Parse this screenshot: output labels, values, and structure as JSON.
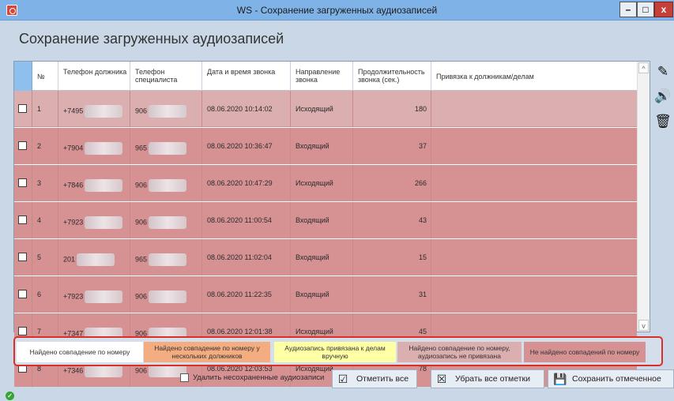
{
  "window": {
    "title": "WS - Сохранение загруженных аудиозаписей",
    "min_glyph": "–",
    "max_glyph": "□",
    "close_glyph": "x"
  },
  "page": {
    "title": "Сохранение загруженных аудиозаписей"
  },
  "grid": {
    "columns": [
      {
        "key": "num",
        "label": "№"
      },
      {
        "key": "debtor_phone",
        "label": "Телефон должника"
      },
      {
        "key": "specialist_phone",
        "label": "Телефон специалиста"
      },
      {
        "key": "datetime",
        "label": "Дата и время звонка"
      },
      {
        "key": "direction",
        "label": "Направление звонка"
      },
      {
        "key": "duration",
        "label": "Продолжительность звонка (сек.)"
      },
      {
        "key": "binding",
        "label": "Привязка к должникам/делам"
      }
    ],
    "rows": [
      {
        "num": "1",
        "debtor_phone": "+7495",
        "specialist_phone": "906",
        "datetime": "08.06.2020 10:14:02",
        "direction": "Исходящий",
        "duration": "180",
        "binding": ""
      },
      {
        "num": "2",
        "debtor_phone": "+7904",
        "specialist_phone": "965",
        "datetime": "08.06.2020 10:36:47",
        "direction": "Входящий",
        "duration": "37",
        "binding": ""
      },
      {
        "num": "3",
        "debtor_phone": "+7846",
        "specialist_phone": "906",
        "datetime": "08.06.2020 10:47:29",
        "direction": "Исходящий",
        "duration": "266",
        "binding": ""
      },
      {
        "num": "4",
        "debtor_phone": "+7923",
        "specialist_phone": "906",
        "datetime": "08.06.2020 11:00:54",
        "direction": "Входящий",
        "duration": "43",
        "binding": ""
      },
      {
        "num": "5",
        "debtor_phone": "201",
        "specialist_phone": "965",
        "datetime": "08.06.2020 11:02:04",
        "direction": "Входящий",
        "duration": "15",
        "binding": ""
      },
      {
        "num": "6",
        "debtor_phone": "+7923",
        "specialist_phone": "906",
        "datetime": "08.06.2020 11:22:35",
        "direction": "Входящий",
        "duration": "31",
        "binding": ""
      },
      {
        "num": "7",
        "debtor_phone": "+7347",
        "specialist_phone": "906",
        "datetime": "08.06.2020 12:01:38",
        "direction": "Исходящий",
        "duration": "45",
        "binding": ""
      },
      {
        "num": "8",
        "debtor_phone": "+7346",
        "specialist_phone": "906",
        "datetime": "08.06.2020 12:03:53",
        "direction": "Исходящий",
        "duration": "78",
        "binding": ""
      }
    ],
    "row_colors": {
      "first": "#dbaeaf",
      "other": "#d69193"
    }
  },
  "side_tools": [
    {
      "name": "edit-pencil-icon",
      "glyph": "✎"
    },
    {
      "name": "speaker-icon",
      "glyph": "🔊"
    },
    {
      "name": "trash-icon",
      "glyph": "🗑"
    }
  ],
  "legend": [
    {
      "name": "legend-found-by-number",
      "label": "Найдено совпадение по номеру",
      "color": "#ffffff"
    },
    {
      "name": "legend-found-multiple-debtors",
      "label": "Найдено совпадение по номеру у нескольких должников",
      "color": "#f4ad80"
    },
    {
      "name": "legend-linked-manually",
      "label": "Аудиозапись привязана к делам вручную",
      "color": "#ffffa6"
    },
    {
      "name": "legend-found-not-linked",
      "label": "Найдено совпадение по номеру, аудиозапись не привязана",
      "color": "#dbaeaf"
    },
    {
      "name": "legend-not-found",
      "label": "Не найдено совпадений по номеру",
      "color": "#d69193"
    }
  ],
  "bottom": {
    "delete_unsaved_label": "Удалить несохраненные аудиозаписи",
    "mark_all_label": "Отметить все",
    "unmark_all_label": "Убрать все отметки",
    "save_marked_label": "Сохранить отмеченное"
  },
  "colors": {
    "titlebar": "#7fb2e6",
    "background": "#c9d7e6",
    "legend_border": "#d92f26",
    "status_ok": "#33a532"
  }
}
